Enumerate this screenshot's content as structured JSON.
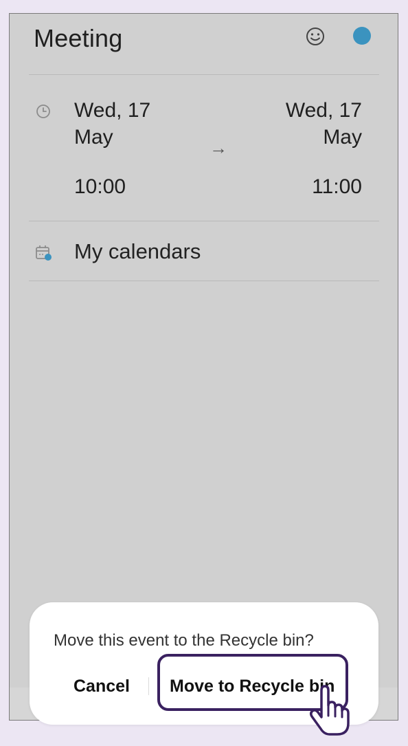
{
  "header": {
    "title": "Meeting",
    "emoji_icon": "smiley-face-icon",
    "color_dot_color": "#3b93bf"
  },
  "event": {
    "start_date_line1": "Wed, 17",
    "start_date_line2": "May",
    "start_time": "10:00",
    "end_date_line1": "Wed, 17",
    "end_date_line2": "May",
    "end_time": "11:00",
    "arrow_glyph": "→",
    "clock_icon": "clock-icon"
  },
  "calendar": {
    "icon": "calendar-icon",
    "label": "My calendars"
  },
  "dialog": {
    "message": "Move this event to the Recycle bin?",
    "cancel_label": "Cancel",
    "confirm_label": "Move to Recycle bin"
  },
  "colors": {
    "background": "#ece6f3",
    "screen": "#d0d0d0",
    "accent_dot": "#3b93bf",
    "highlight_border": "#3a2160"
  }
}
